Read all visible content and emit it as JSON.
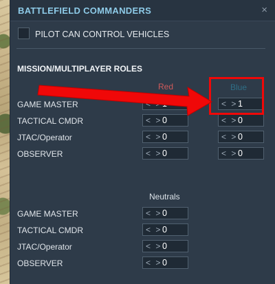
{
  "window": {
    "title": "BATTLEFIELD COMMANDERS",
    "close_symbol": "×"
  },
  "pilot": {
    "label": "PILOT CAN CONTROL VEHICLES",
    "checked": false
  },
  "section": {
    "title": "MISSION/MULTIPLAYER ROLES"
  },
  "columns": {
    "red": "Red",
    "blue": "Blue",
    "neutrals": "Neutrals"
  },
  "arrows_glyph": "< >",
  "roles": [
    {
      "label": "GAME MASTER",
      "red": "1",
      "blue": "1"
    },
    {
      "label": "TACTICAL CMDR",
      "red": "0",
      "blue": "0"
    },
    {
      "label": "JTAC/Operator",
      "red": "0",
      "blue": "0"
    },
    {
      "label": "OBSERVER",
      "red": "0",
      "blue": "0"
    }
  ],
  "neutral_roles": [
    {
      "label": "GAME MASTER",
      "value": "0"
    },
    {
      "label": "TACTICAL CMDR",
      "value": "0"
    },
    {
      "label": "JTAC/Operator",
      "value": "0"
    },
    {
      "label": "OBSERVER",
      "value": "0"
    }
  ],
  "colors": {
    "title": "#8ecbe8",
    "red": "#cf5a5a",
    "blue": "#2f6f86",
    "annotation": "#f00808"
  }
}
